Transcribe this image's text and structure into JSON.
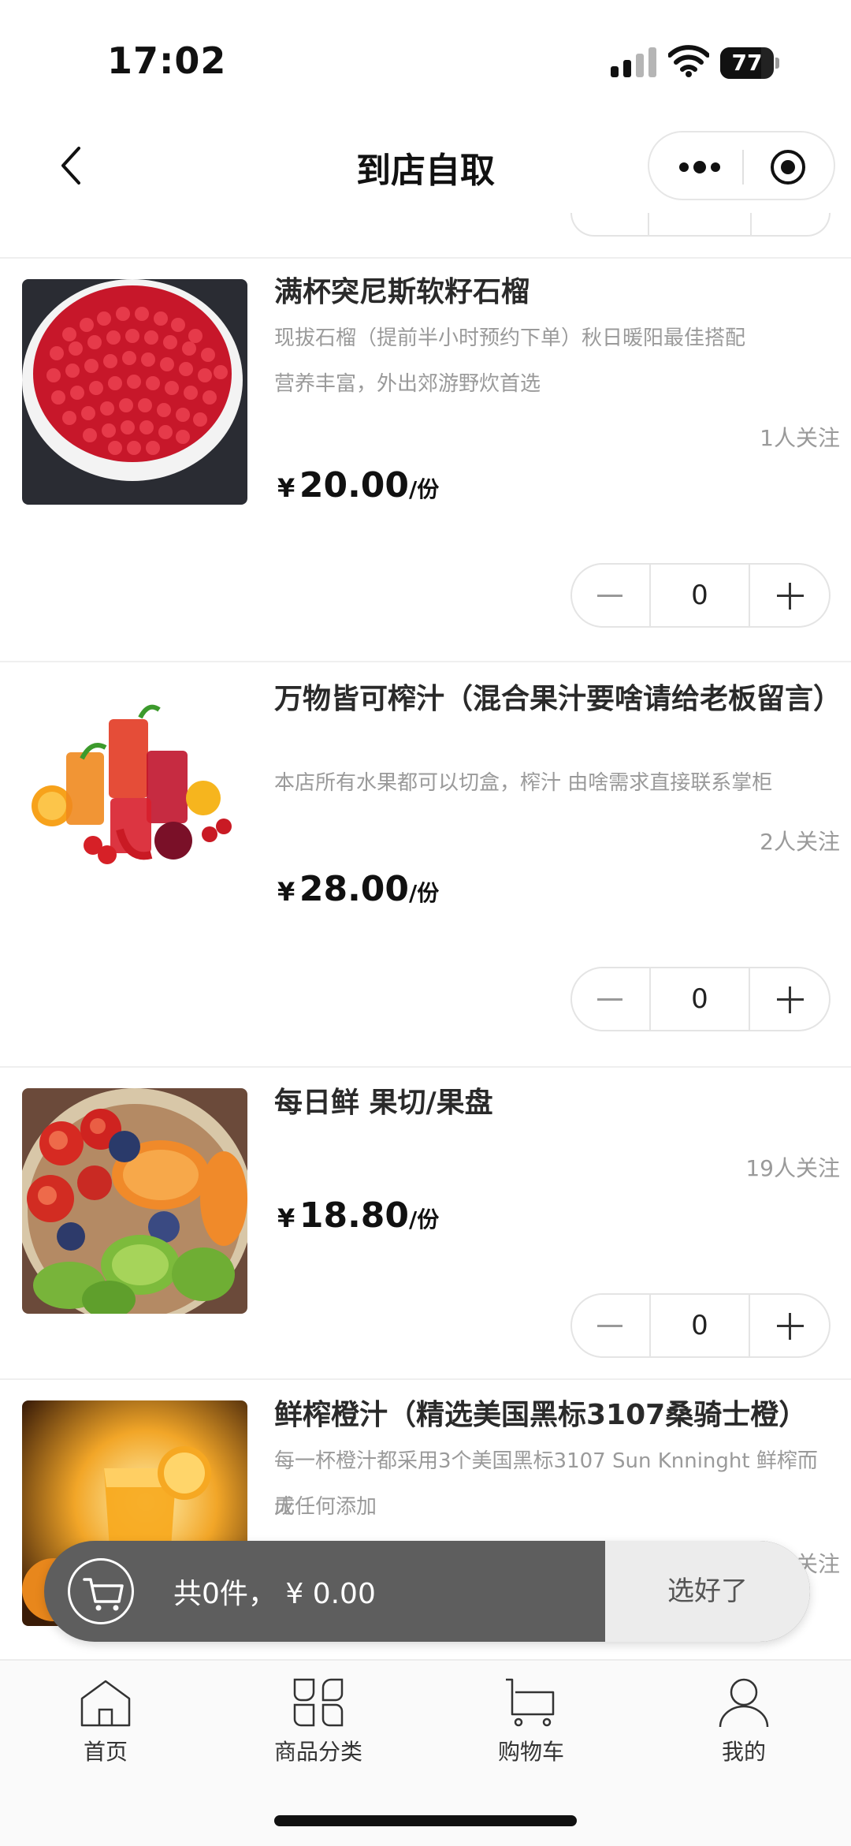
{
  "status_bar": {
    "time": "17:02",
    "battery": "77",
    "battery_level": 0.77
  },
  "nav": {
    "title": "到店自取",
    "back_icon": "chevron-left-icon",
    "more_icon": "more-dots-icon",
    "target_icon": "target-icon"
  },
  "products": [
    {
      "name": "满杯突尼斯软籽石榴",
      "desc": [
        "现拔石榴（提前半小时预约下单）秋日暖阳最佳搭配",
        "营养丰富，外出郊游野炊首选"
      ],
      "followers": "1人关注",
      "currency": "¥",
      "price": "20.00",
      "unit": "/份",
      "qty": "0"
    },
    {
      "name": "万物皆可榨汁（混合果汁要啥请给老板留言）",
      "desc": [
        "本店所有水果都可以切盒，榨汁 由啥需求直接联系掌柜"
      ],
      "followers": "2人关注",
      "currency": "¥",
      "price": "28.00",
      "unit": "/份",
      "qty": "0"
    },
    {
      "name": "每日鲜 果切/果盘",
      "desc": [],
      "followers": "19人关注",
      "currency": "¥",
      "price": "18.80",
      "unit": "/份",
      "qty": "0"
    },
    {
      "name": "鲜榨橙汁（精选美国黑标3107桑骑士橙）",
      "desc": [
        "每一杯橙汁都采用3个美国黑标3107 Sun Knninght 鲜榨而成",
        "无任何添加"
      ],
      "followers": "关注"
    }
  ],
  "cart": {
    "summary": "共0件，  ¥ 0.00",
    "confirm": "选好了"
  },
  "tabs": [
    {
      "label": "首页",
      "icon": "home-icon"
    },
    {
      "label": "商品分类",
      "icon": "category-icon"
    },
    {
      "label": "购物车",
      "icon": "cart-icon"
    },
    {
      "label": "我的",
      "icon": "user-icon"
    }
  ]
}
